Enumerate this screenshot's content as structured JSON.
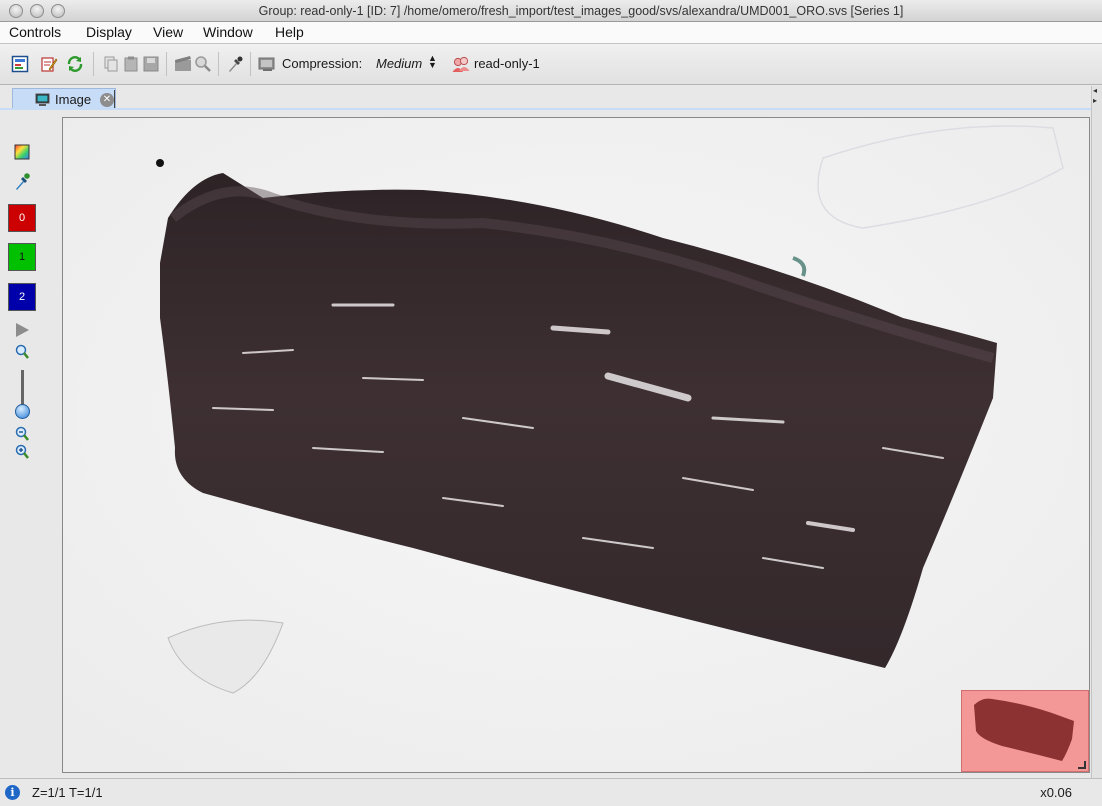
{
  "window": {
    "title": "Group: read-only-1 [ID: 7]  /home/omero/fresh_import/test_images_good/svs/alexandra/UMD001_ORO.svs [Series 1]"
  },
  "menubar": {
    "items": [
      "Controls",
      "Display",
      "View",
      "Window",
      "Help"
    ]
  },
  "toolbar": {
    "compression_label": "Compression:",
    "compression_value": "Medium",
    "group_label": "read-only-1",
    "icons": [
      "rendering-settings-icon",
      "edit-icon",
      "refresh-icon",
      "copy-icon",
      "paste-icon",
      "save-icon",
      "movie-icon",
      "magnifier-icon",
      "pipette-icon",
      "image-icon",
      "group-users-icon"
    ]
  },
  "tabs": [
    {
      "label": "Image",
      "icon": "image-icon"
    }
  ],
  "channels": [
    {
      "label": "0",
      "color": "#cc0000"
    },
    {
      "label": "1",
      "color": "#00c000"
    },
    {
      "label": "2",
      "color": "#0000aa"
    }
  ],
  "status": {
    "dims": "Z=1/1 T=1/1",
    "zoom": "x0.06"
  },
  "colors": {
    "tab_accent": "#c7dcf7",
    "tissue": "#3a2d2c",
    "birdseye": "#f39797"
  }
}
